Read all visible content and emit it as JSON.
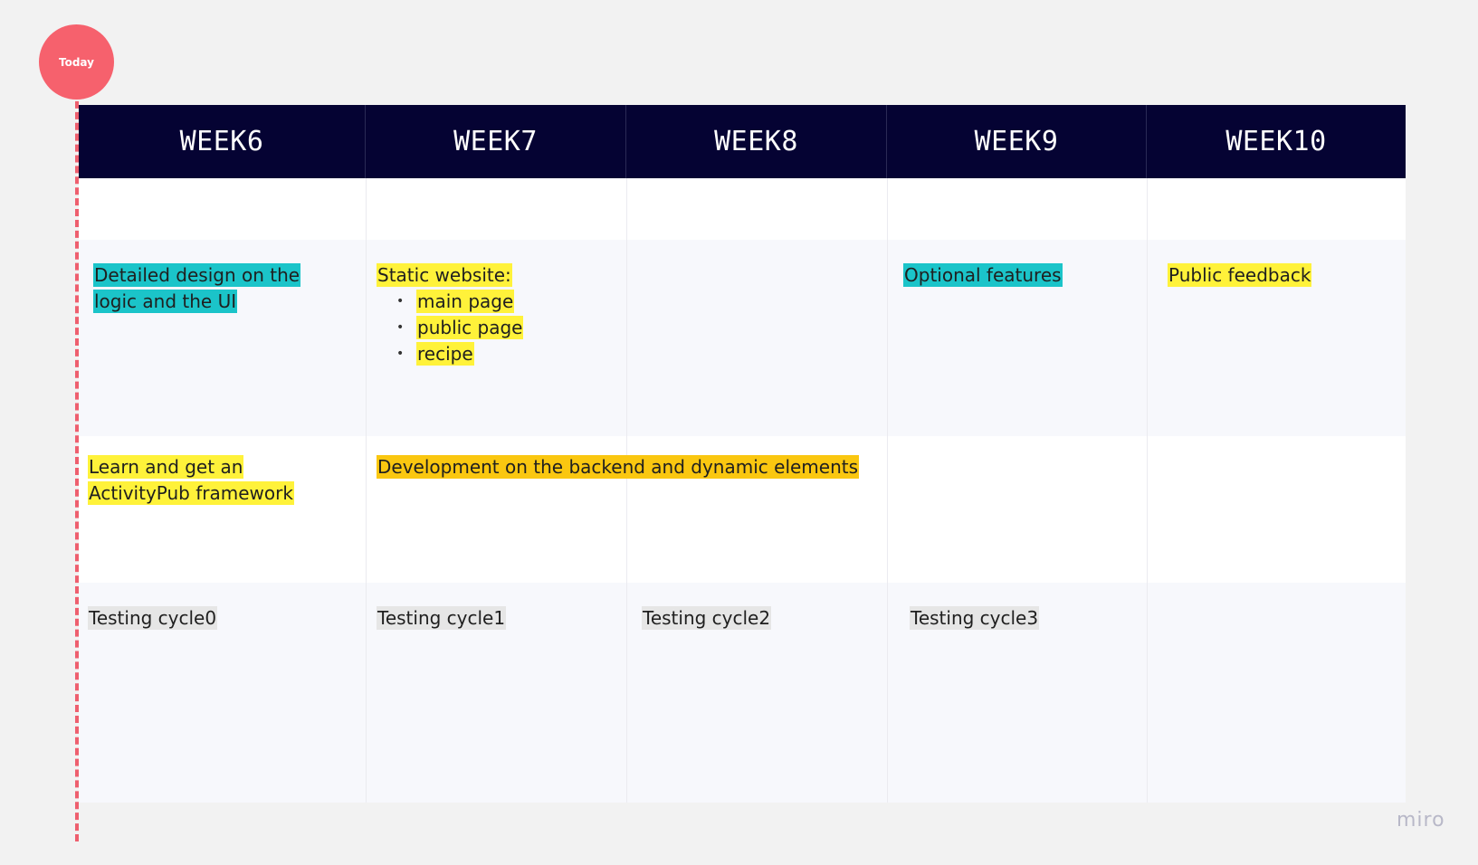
{
  "today_marker": {
    "label": "Today",
    "color": "#f6616d"
  },
  "weeks": [
    "WEEK6",
    "WEEK7",
    "WEEK8",
    "WEEK9",
    "WEEK10"
  ],
  "rows": {
    "design": {
      "week6": "Detailed design on the logic and the UI",
      "week7": {
        "title": "Static website:",
        "items": [
          "main page",
          "public page",
          "recipe"
        ]
      },
      "week9": "Optional features",
      "week10": "Public feedback"
    },
    "dev": {
      "week6": "Learn and get an ActivityPub framework",
      "week7_8": "Development on the backend and dynamic elements"
    },
    "testing": [
      "Testing cycle0",
      "Testing cycle1",
      "Testing cycle2",
      "Testing cycle3"
    ]
  },
  "colors": {
    "header_bg": "#050333",
    "cyan": "#1bc4c9",
    "yellow": "#fff23a",
    "orange": "#fac710",
    "gray": "#e6e6e6"
  },
  "brand": "miro"
}
